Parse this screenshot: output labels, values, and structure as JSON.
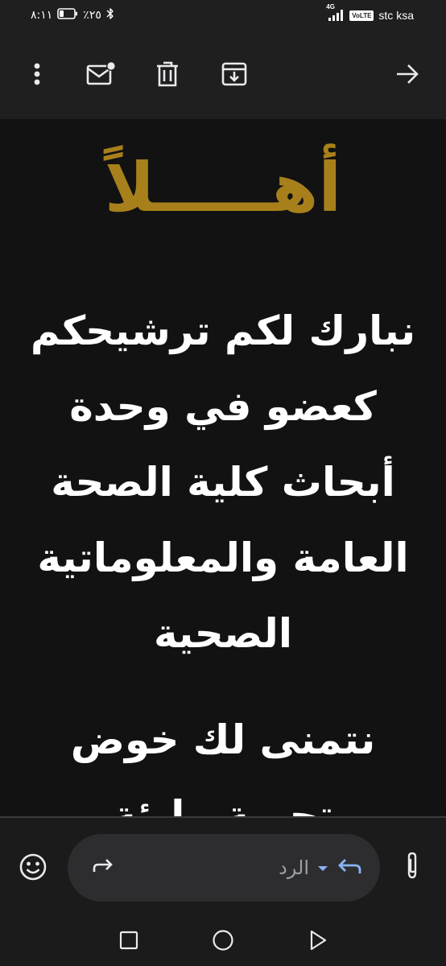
{
  "status_bar": {
    "time": "٨:١١",
    "battery": "٪٢٥",
    "network": "4G",
    "volte": "VoLTE",
    "carrier": "stc ksa"
  },
  "toolbar": {
    "icons": [
      "more-vert-icon",
      "mark-unread-icon",
      "delete-icon",
      "archive-icon",
      "forward-arrow-icon"
    ]
  },
  "message": {
    "greeting": "أهـــــلاً",
    "paragraph_1": "نبارك لكم ترشيحكم كعضو في وحدة أبحاث كلية الصحة العامة والمعلوماتية الصحية",
    "paragraph_2": "نتمنى لك خوض تجربة مليئة"
  },
  "reply_bar": {
    "placeholder": "الرد",
    "icons": [
      "emoji-icon",
      "forward-icon",
      "reply-icon",
      "dropdown-icon",
      "attach-icon"
    ]
  },
  "nav_bar": {
    "icons": [
      "recents-icon",
      "home-icon",
      "back-icon"
    ]
  },
  "colors": {
    "greeting": "#a8801b",
    "background": "#121212",
    "toolbar": "#1f1f1f",
    "reply_accent": "#8ab4f8"
  }
}
